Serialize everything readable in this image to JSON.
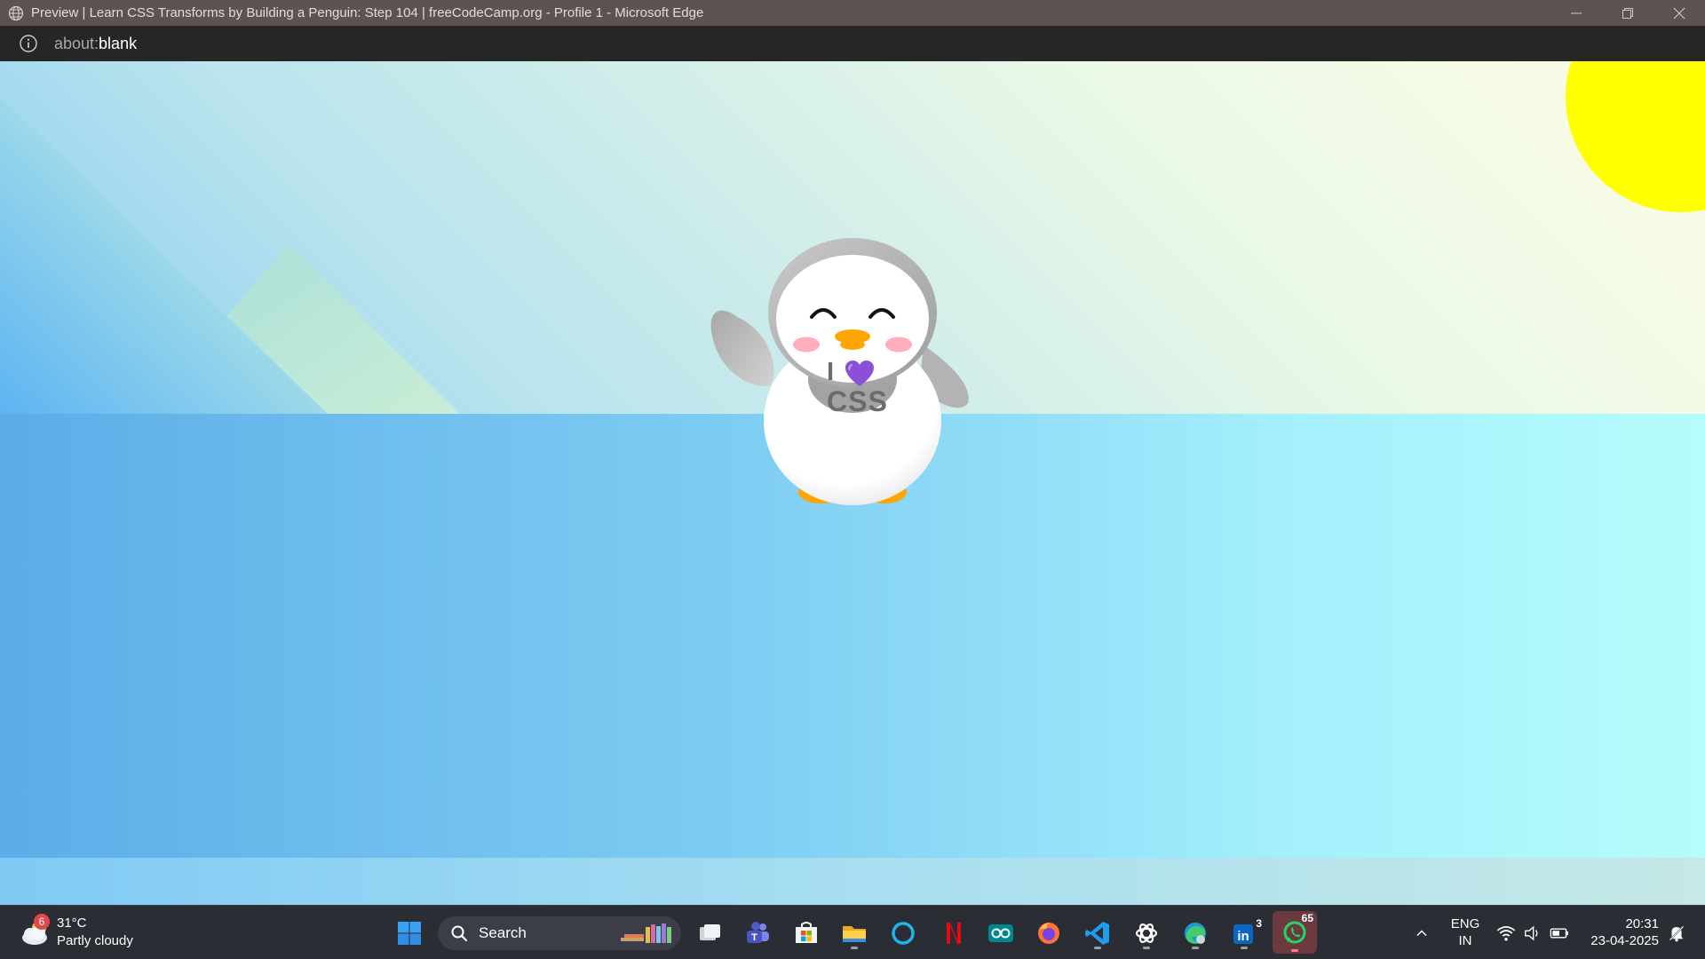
{
  "window": {
    "title": "Preview | Learn CSS Transforms by Building a Penguin: Step 104 | freeCodeCamp.org - Profile 1 - Microsoft Edge",
    "controls": [
      "minimize-icon",
      "restore-icon",
      "close-icon"
    ]
  },
  "addressbar": {
    "scheme": "about:",
    "path": "blank"
  },
  "page": {
    "shirt_text_top": "I",
    "shirt_heart_icon": "purple-heart-icon",
    "shirt_text_bottom": "CSS",
    "colors": {
      "sun": "#ffff00",
      "ground_left": "#5cade8",
      "ground_right": "#b5fcfc",
      "heart": "#8b4fd8",
      "beak": "#ffa500"
    }
  },
  "taskbar": {
    "weather": {
      "temperature": "31°C",
      "condition": "Partly cloudy",
      "badge": "6"
    },
    "search_placeholder": "Search",
    "apps": [
      {
        "name": "start",
        "icon": "windows-start-icon"
      },
      {
        "name": "task-view",
        "icon": "task-view-icon"
      },
      {
        "name": "teams",
        "icon": "teams-icon"
      },
      {
        "name": "store",
        "icon": "store-icon"
      },
      {
        "name": "file-explorer",
        "icon": "folder-icon"
      },
      {
        "name": "cortana",
        "icon": "cortana-icon"
      },
      {
        "name": "netflix",
        "icon": "netflix-icon"
      },
      {
        "name": "arduino",
        "icon": "arduino-icon"
      },
      {
        "name": "firefox",
        "icon": "firefox-icon"
      },
      {
        "name": "vscode",
        "icon": "vscode-icon"
      },
      {
        "name": "chatgpt",
        "icon": "chatgpt-icon"
      },
      {
        "name": "edge",
        "icon": "edge-icon"
      },
      {
        "name": "linkedin",
        "icon": "linkedin-icon",
        "badge": "3"
      },
      {
        "name": "whatsapp",
        "icon": "whatsapp-icon",
        "badge": "65"
      }
    ],
    "tray": {
      "language_line1": "ENG",
      "language_line2": "IN",
      "time": "20:31",
      "date": "23-04-2025"
    }
  }
}
